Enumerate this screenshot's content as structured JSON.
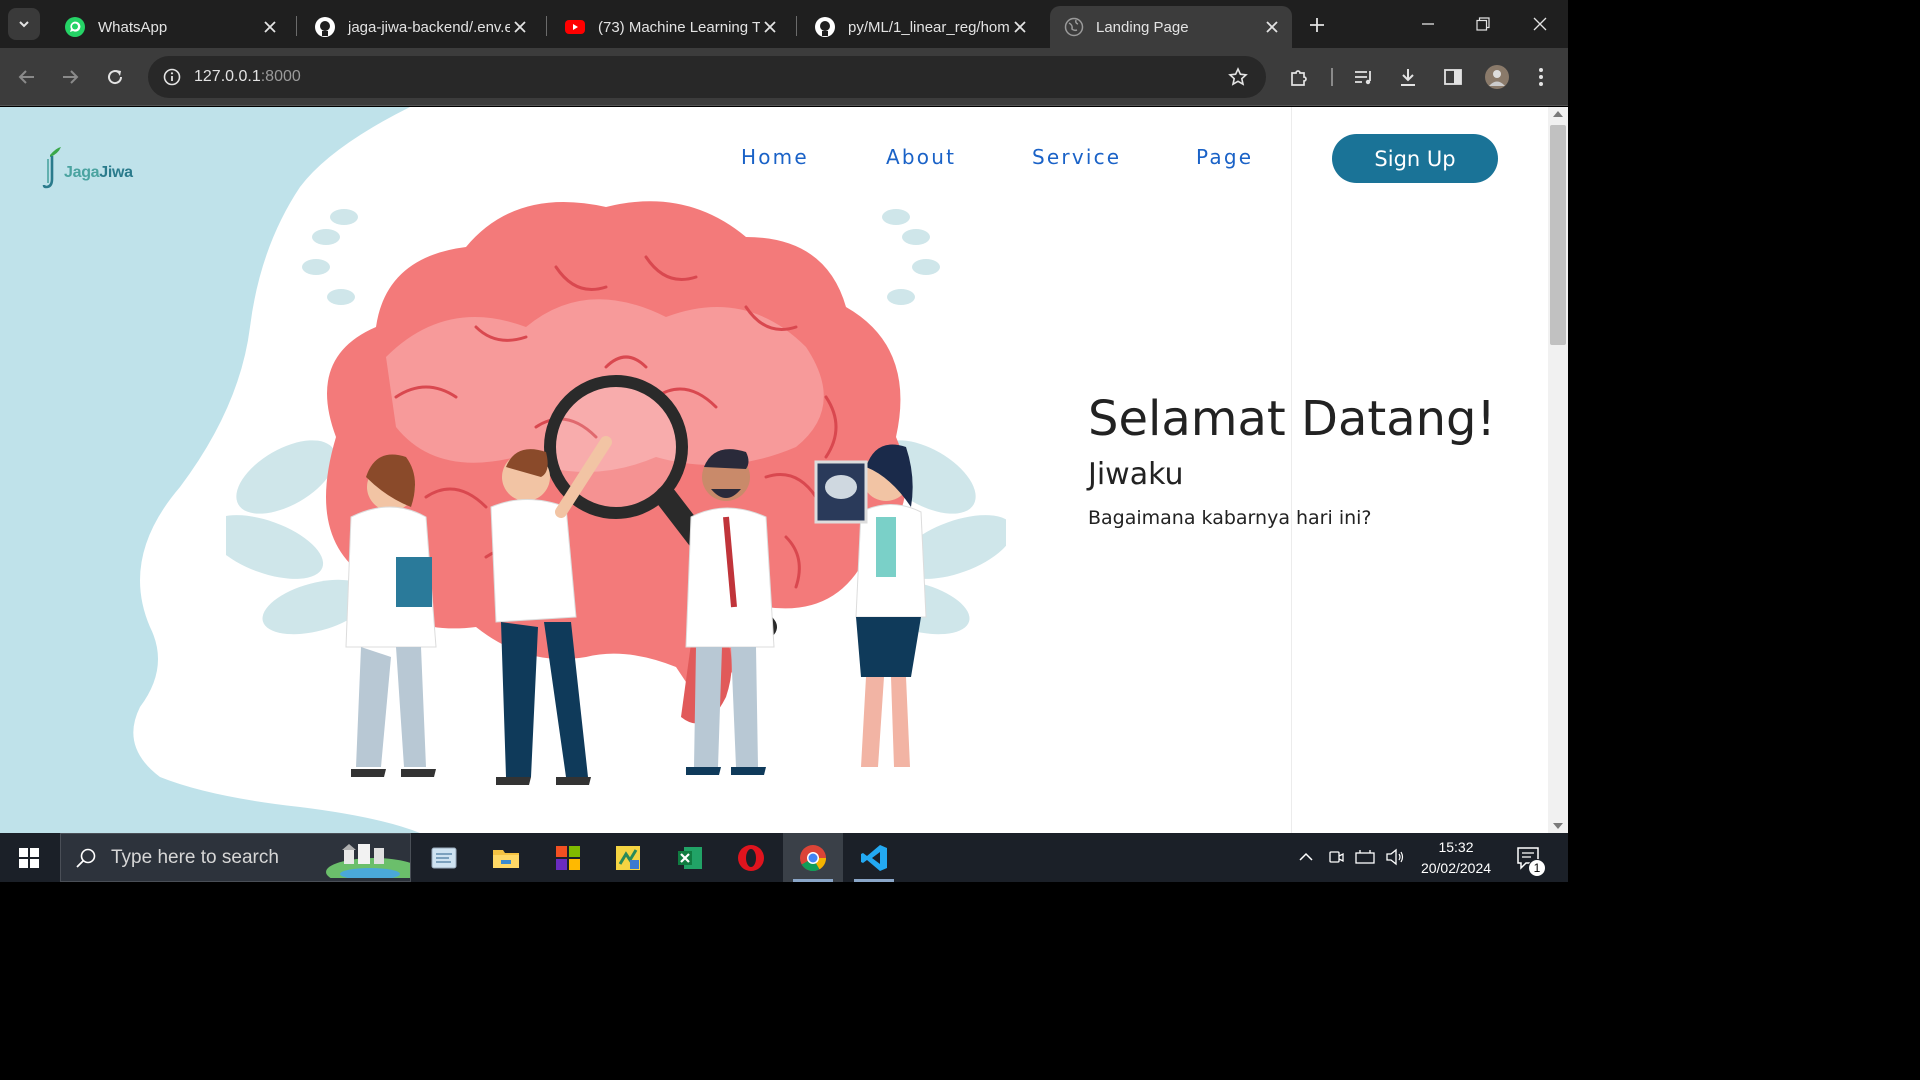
{
  "browser": {
    "tabs": [
      {
        "title": "WhatsApp",
        "icon": "whatsapp-icon"
      },
      {
        "title": "jaga-jiwa-backend/.env.e",
        "icon": "github-icon"
      },
      {
        "title": "(73) Machine Learning Tu",
        "icon": "youtube-icon"
      },
      {
        "title": "py/ML/1_linear_reg/hom",
        "icon": "github-icon"
      },
      {
        "title": "Landing Page",
        "icon": "globe-icon",
        "active": true
      }
    ],
    "url_host": "127.0.0.1",
    "url_port": ":8000"
  },
  "page": {
    "logo": {
      "part1": "Jaga",
      "part2": "Jiwa"
    },
    "nav": [
      "Home",
      "About",
      "Service",
      "Page"
    ],
    "signup_label": "Sign Up",
    "hero": {
      "title": "Selamat Datang!",
      "subtitle": "Jiwaku",
      "text": "Bagaimana kabarnya hari ini?"
    },
    "colors": {
      "accent": "#1a7397",
      "nav_link": "#1a62c7",
      "background_shape": "#bfe2ea",
      "brain": "#f37a7a"
    }
  },
  "taskbar": {
    "search_placeholder": "Type here to search",
    "apps": [
      "file-explorer-icon",
      "folder-icon",
      "store-icon",
      "app-icon",
      "excel-icon",
      "opera-icon",
      "chrome-icon",
      "vscode-icon"
    ],
    "time": "15:32",
    "date": "20/02/2024",
    "notification_count": "1"
  }
}
